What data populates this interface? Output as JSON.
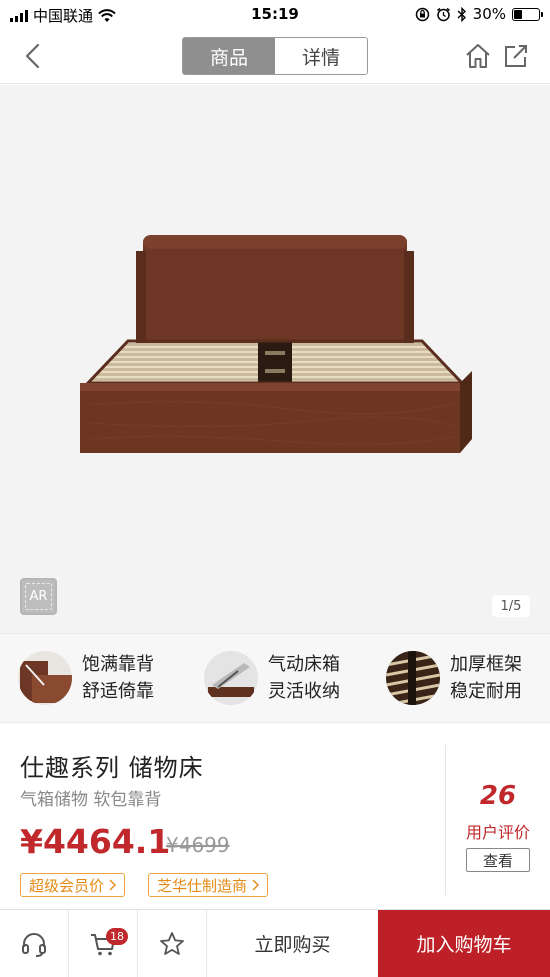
{
  "status_bar": {
    "carrier": "中国联通",
    "time": "15:19",
    "battery": "30%",
    "battery_level": 0.3
  },
  "nav": {
    "tabs": [
      {
        "label": "商品",
        "active": true
      },
      {
        "label": "详情",
        "active": false
      }
    ]
  },
  "gallery": {
    "ar_label": "AR",
    "pager": "1/5"
  },
  "features": [
    {
      "line1": "饱满靠背",
      "line2": "舒适倚靠"
    },
    {
      "line1": "气动床箱",
      "line2": "灵活收纳"
    },
    {
      "line1": "加厚框架",
      "line2": "稳定耐用"
    }
  ],
  "product": {
    "title": "仕趣系列 储物床",
    "subtitle": "气箱储物 软包靠背",
    "price": "¥4464.1",
    "original_price": "¥4699",
    "tags": [
      "超级会员价",
      "芝华仕制造商"
    ]
  },
  "rating": {
    "count": "26",
    "label": "用户评价",
    "button": "查看"
  },
  "bottom_bar": {
    "cart_badge": "18",
    "buy_now": "立即购买",
    "add_to_cart": "加入购物车"
  },
  "colors": {
    "accent_red": "#bd2127",
    "price_red": "#c0282c",
    "tag_orange": "#f0a13b"
  }
}
